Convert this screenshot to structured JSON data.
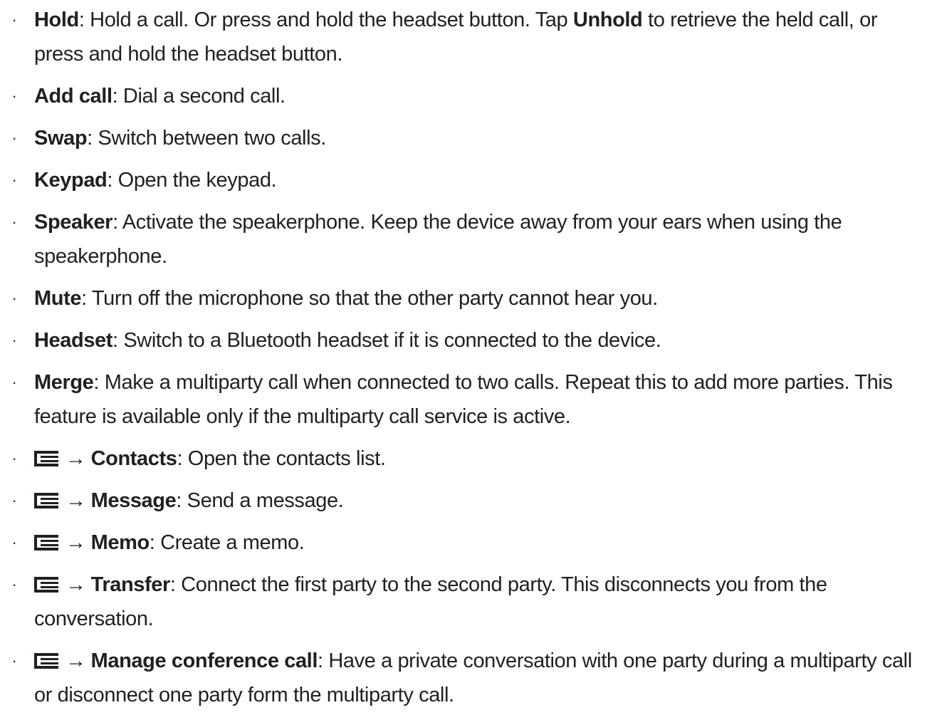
{
  "list": {
    "bullet_glyph": "·",
    "items": [
      {
        "term": "Hold",
        "text": ": Hold a call. Or press and hold the headset button. Tap ",
        "term2": "Unhold",
        "text2": " to retrieve the held call, or press and hold the headset button."
      },
      {
        "term": "Add call",
        "text": ": Dial a second call."
      },
      {
        "term": "Swap",
        "text": ": Switch between two calls."
      },
      {
        "term": "Keypad",
        "text": ": Open the keypad."
      },
      {
        "term": "Speaker",
        "text": ": Activate the speakerphone. Keep the device away from your ears when using the speakerphone."
      },
      {
        "term": "Mute",
        "text": ": Turn off the microphone so that the other party cannot hear you."
      },
      {
        "term": "Headset",
        "text": ": Switch to a Bluetooth headset if it is connected to the device."
      },
      {
        "term": "Merge",
        "text": ": Make a multiparty call when connected to two calls. Repeat this to add more parties. This feature is available only if the multiparty call service is active."
      },
      {
        "icon": "menu-icon",
        "arrow": "→",
        "term": "Contacts",
        "text": ": Open the contacts list."
      },
      {
        "icon": "menu-icon",
        "arrow": "→",
        "term": "Message",
        "text": ": Send a message."
      },
      {
        "icon": "menu-icon",
        "arrow": "→",
        "term": "Memo",
        "text": ": Create a memo."
      },
      {
        "icon": "menu-icon",
        "arrow": "→",
        "term": "Transfer",
        "text": ": Connect the first party to the second party. This disconnects you from the conversation."
      },
      {
        "icon": "menu-icon",
        "arrow": "→",
        "term": "Manage conference call",
        "text": ": Have a private conversation with one party during a multiparty call or disconnect one party form the multiparty call."
      }
    ]
  }
}
